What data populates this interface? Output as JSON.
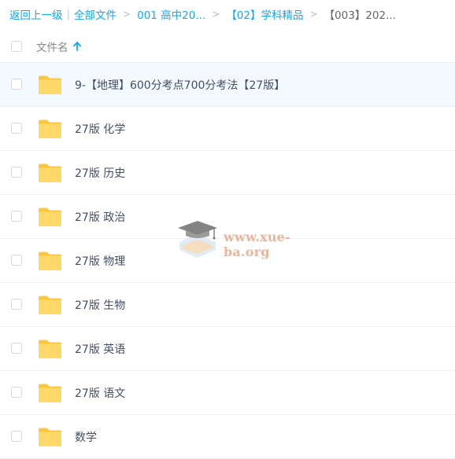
{
  "breadcrumb": {
    "back": "返回上一级",
    "items": [
      "全部文件",
      "001 高中20...",
      "【02】学科精品",
      "【003】202..."
    ]
  },
  "header": {
    "column_name": "文件名"
  },
  "rows": [
    {
      "name": "9-【地理】600分考点700分考法【27版】",
      "selected": true
    },
    {
      "name": "27版 化学"
    },
    {
      "name": "27版 历史"
    },
    {
      "name": "27版 政治"
    },
    {
      "name": "27版 物理"
    },
    {
      "name": "27版 生物"
    },
    {
      "name": "27版 英语"
    },
    {
      "name": "27版 语文"
    },
    {
      "name": "数学"
    }
  ],
  "watermark": {
    "text": "www.xue-ba.org"
  },
  "colors": {
    "link": "#09aaff",
    "folder": "#ffd459",
    "selected_row": "#f2f9ff"
  },
  "icons": {
    "sort": "arrow-up-icon",
    "folder": "folder-icon",
    "watermark": "graduation-cap-logo"
  }
}
